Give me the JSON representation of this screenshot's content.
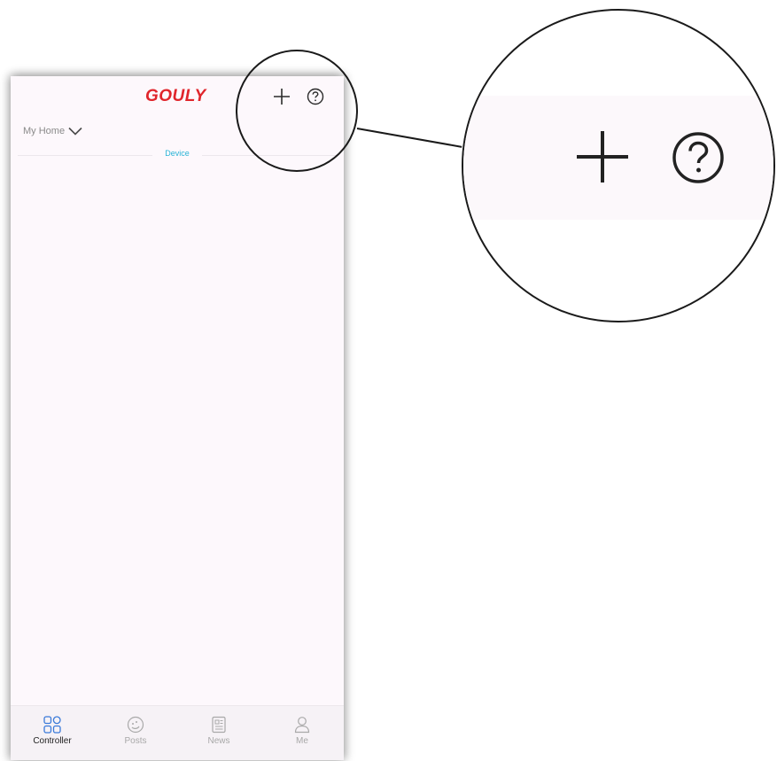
{
  "app": {
    "brand": "GOULY",
    "brand_color": "#e0252b",
    "accent_color": "#29b4d6"
  },
  "header": {
    "home_selector": "My Home",
    "add_icon": "plus-icon",
    "help_icon": "question-circle-icon"
  },
  "tabs": {
    "device": "Device"
  },
  "bottom_nav": [
    {
      "label": "Controller",
      "icon": "grid-apps-icon",
      "active": true
    },
    {
      "label": "Posts",
      "icon": "chat-bubble-icon",
      "active": false
    },
    {
      "label": "News",
      "icon": "newspaper-icon",
      "active": false
    },
    {
      "label": "Me",
      "icon": "person-icon",
      "active": false
    }
  ],
  "callout": {
    "add_icon": "plus-icon",
    "help_icon": "question-circle-icon"
  }
}
